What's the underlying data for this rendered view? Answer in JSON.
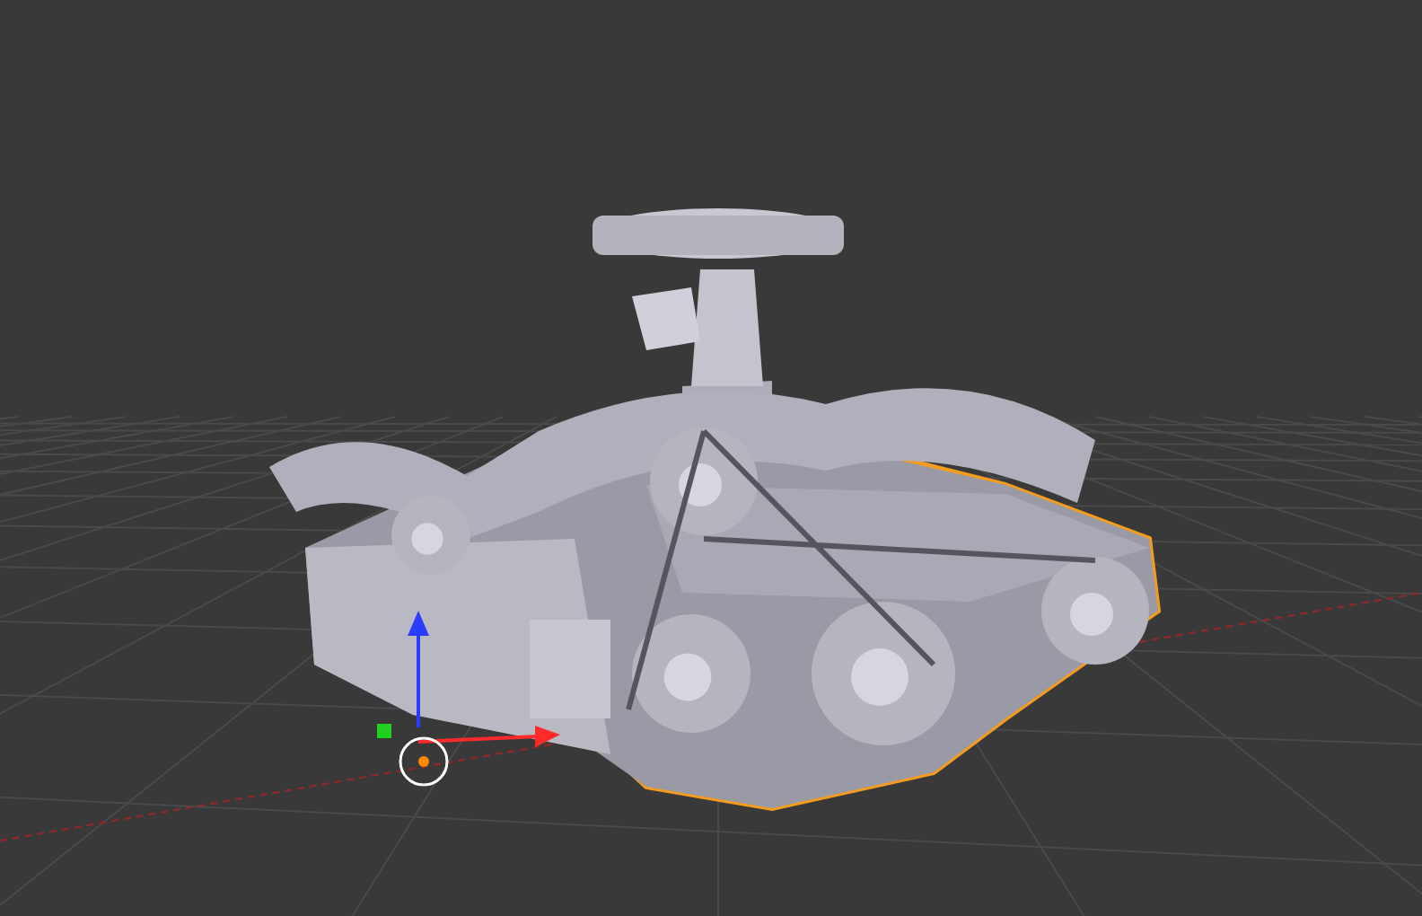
{
  "viewport": {
    "object_selected": true
  }
}
